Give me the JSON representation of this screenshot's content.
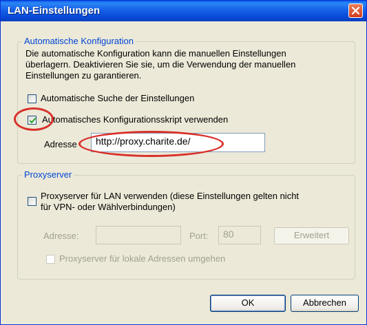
{
  "window": {
    "title": "LAN-Einstellungen"
  },
  "auto_config": {
    "legend": "Automatische Konfiguration",
    "description_lines": [
      "Die automatische Konfiguration kann die manuellen Einstellungen",
      "überlagern. Deaktivieren Sie sie, um die Verwendung der manuellen",
      "Einstellungen zu garantieren."
    ],
    "auto_detect_label": "Automatische Suche der Einstellungen",
    "auto_detect_checked": false,
    "use_script_label": "Automatisches Konfigurationsskript verwenden",
    "use_script_checked": true,
    "address_label": "Adresse",
    "address_value": "http://proxy.charite.de/"
  },
  "proxy": {
    "legend": "Proxyserver",
    "use_proxy_label_lines": [
      "Proxyserver für LAN verwenden (diese Einstellungen gelten nicht",
      "für VPN- oder Wählverbindungen)"
    ],
    "use_proxy_checked": false,
    "address_label": "Adresse:",
    "address_value": "",
    "port_label": "Port:",
    "port_value": "80",
    "advanced_button": "Erweitert",
    "bypass_local_label": "Proxyserver für lokale Adressen umgehen",
    "bypass_local_checked": false
  },
  "buttons": {
    "ok": "OK",
    "cancel": "Abbrechen"
  },
  "colors": {
    "titlebar": "#0a5fe6",
    "legend": "#0046d5",
    "annotation": "#d9302a",
    "dialog_bg": "#ece9d8"
  }
}
